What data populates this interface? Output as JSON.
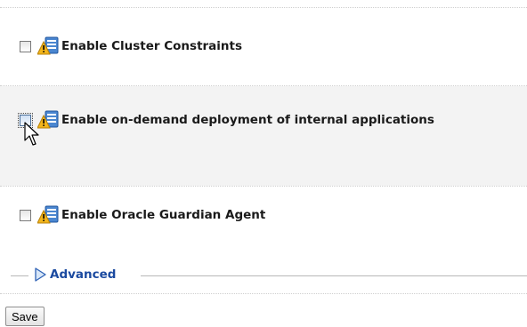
{
  "options": [
    {
      "label": "Enable Cluster Constraints",
      "checked": false
    },
    {
      "label": "Enable on-demand deployment of internal applications",
      "checked": false,
      "focused": true
    },
    {
      "label": "Enable Oracle Guardian Agent",
      "checked": false
    }
  ],
  "icons": {
    "option_icon": "warning-config-icon",
    "cursor": "arrow-cursor-icon",
    "advanced_toggle": "expand-arrow-icon"
  },
  "advanced": {
    "label": "Advanced",
    "expanded": false
  },
  "save_button": {
    "label": "Save"
  },
  "colors": {
    "link_blue": "#1b4aa0",
    "shaded_row": "#f3f3f3",
    "warning_yellow": "#f3b51b",
    "config_blue": "#3a78c8"
  }
}
